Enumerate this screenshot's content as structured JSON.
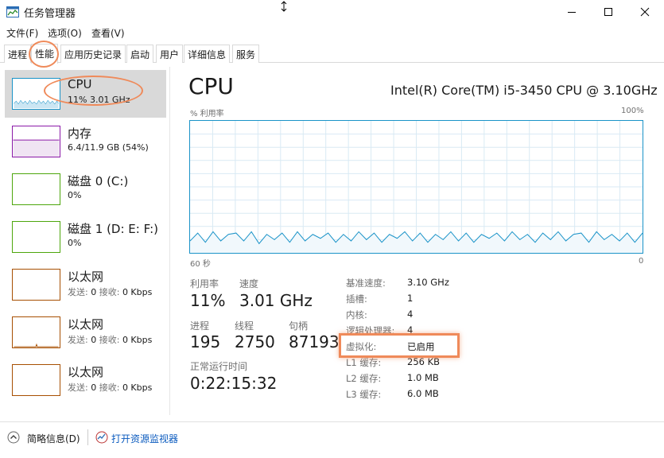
{
  "window": {
    "title": "任务管理器",
    "icons": {
      "app": "task-manager-icon",
      "minimize": "minimize-icon",
      "maximize": "maximize-icon",
      "close": "close-icon",
      "cursor": "resize-cursor-icon"
    }
  },
  "menu": {
    "items": [
      "文件(F)",
      "选项(O)",
      "查看(V)"
    ]
  },
  "tabs": [
    "进程",
    "性能",
    "应用历史记录",
    "启动",
    "用户",
    "详细信息",
    "服务"
  ],
  "sidebar": {
    "items": [
      {
        "name": "CPU",
        "detail": "11%  3.01 GHz",
        "color": "#1a93c8"
      },
      {
        "name": "内存",
        "detail": "6.4/11.9 GB (54%)",
        "color": "#8b1aa8"
      },
      {
        "name": "磁盘 0 (C:)",
        "detail": "0%",
        "color": "#4da60c"
      },
      {
        "name": "磁盘 1 (D: E: F:)",
        "detail": "0%",
        "color": "#4da60c"
      },
      {
        "name": "以太网",
        "send_lbl": "发送:",
        "send_val": "0",
        "recv_lbl": "接收:",
        "recv_val": "0 Kbps",
        "color": "#a74f01"
      },
      {
        "name": "以太网",
        "send_lbl": "发送:",
        "send_val": "0",
        "recv_lbl": "接收:",
        "recv_val": "0 Kbps",
        "color": "#a74f01"
      },
      {
        "name": "以太网",
        "send_lbl": "发送:",
        "send_val": "0",
        "recv_lbl": "接收:",
        "recv_val": "0 Kbps",
        "color": "#a74f01"
      }
    ]
  },
  "main": {
    "title": "CPU",
    "model": "Intel(R) Core(TM) i5-3450 CPU @ 3.10GHz",
    "graph": {
      "y_label": "% 利用率",
      "y_max_label": "100%",
      "x_left_label": "60 秒",
      "x_right_label": "0",
      "utilization_percent": [
        9,
        15,
        8,
        16,
        9,
        14,
        15,
        9,
        16,
        7,
        14,
        10,
        15,
        8,
        16,
        9,
        14,
        11,
        15,
        8,
        14,
        9,
        16,
        10,
        15,
        8,
        14,
        11,
        16,
        9,
        15,
        8,
        14,
        10,
        16,
        9,
        15,
        8,
        14,
        11,
        15,
        9,
        16,
        10,
        14,
        8,
        15,
        10,
        16,
        9,
        14,
        15,
        8,
        16,
        10,
        14,
        9,
        15,
        8,
        15
      ]
    },
    "stats": {
      "util_lbl": "利用率",
      "util_val": "11%",
      "speed_lbl": "速度",
      "speed_val": "3.01 GHz",
      "proc_lbl": "进程",
      "proc_val": "195",
      "thread_lbl": "线程",
      "thread_val": "2750",
      "handle_lbl": "句柄",
      "handle_val": "87193",
      "uptime_lbl": "正常运行时间",
      "uptime_val": "0:22:15:32"
    },
    "info": [
      {
        "label": "基准速度:",
        "value": "3.10 GHz"
      },
      {
        "label": "插槽:",
        "value": "1"
      },
      {
        "label": "内核:",
        "value": "4"
      },
      {
        "label": "逻辑处理器:",
        "value": "4"
      },
      {
        "label": "虚拟化:",
        "value": "已启用"
      },
      {
        "label": "L1 缓存:",
        "value": "256 KB"
      },
      {
        "label": "L2 缓存:",
        "value": "1.0 MB"
      },
      {
        "label": "L3 缓存:",
        "value": "6.0 MB"
      }
    ]
  },
  "footer": {
    "summary_label": "简略信息(D)",
    "monitor_link": "打开资源监视器",
    "icons": {
      "summary": "collapse-chevron-icon",
      "monitor": "resource-monitor-icon"
    }
  },
  "colors": {
    "accent": "#1a93c8",
    "annotation": "#ef8a5a"
  }
}
